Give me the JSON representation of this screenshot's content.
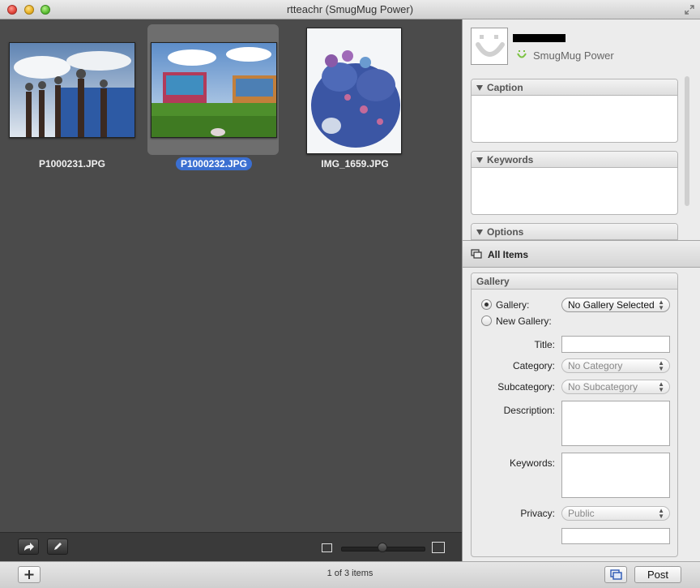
{
  "window": {
    "title": "rtteachr (SmugMug Power)"
  },
  "browser": {
    "thumbnails": [
      {
        "label": "P1000231.JPG",
        "selected": false
      },
      {
        "label": "P1000232.JPG",
        "selected": true
      },
      {
        "label": "IMG_1659.JPG",
        "selected": false
      }
    ],
    "toolbar": {
      "share_icon": "share-arrow-icon",
      "edit_icon": "pencil-icon"
    }
  },
  "status": {
    "text": "1 of 3 items",
    "post_label": "Post"
  },
  "account": {
    "type": "SmugMug Power"
  },
  "sections": {
    "caption": "Caption",
    "keywords": "Keywords",
    "options": "Options"
  },
  "all_items": {
    "label": "All Items"
  },
  "gallery": {
    "header": "Gallery",
    "gallery_radio_label": "Gallery:",
    "new_gallery_radio_label": "New Gallery:",
    "gallery_select": "No Gallery Selected",
    "title_label": "Title:",
    "category_label": "Category:",
    "category_value": "No Category",
    "subcategory_label": "Subcategory:",
    "subcategory_value": "No Subcategory",
    "description_label": "Description:",
    "keywords_label": "Keywords:",
    "privacy_label": "Privacy:",
    "privacy_value": "Public"
  },
  "colors": {
    "accent_selection": "#3b6fd1",
    "smugmug_green": "#7cc242"
  }
}
